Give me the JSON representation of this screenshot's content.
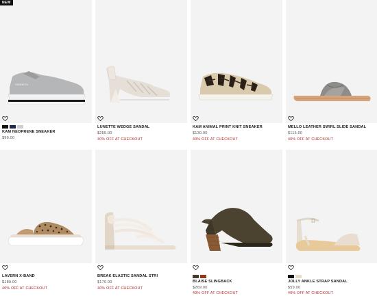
{
  "products": [
    {
      "badge": "NEW",
      "name": "KAM NEOPRENE SNEAKER",
      "price": "$99.00",
      "promo": "",
      "swatches": [
        "#111111",
        "#1d2a4a",
        "#cfcfcf"
      ],
      "icon": "heart-outline-icon"
    },
    {
      "badge": "",
      "name": "LUNETTE WEDGE SANDAL",
      "price": "$255.00",
      "promo": "40% OFF AT CHECKOUT",
      "swatches": [],
      "icon": "heart-outline-icon"
    },
    {
      "badge": "",
      "name": "KAM ANIMAL PRINT KNIT SNEAKER",
      "price": "$130.00",
      "promo": "40% OFF AT CHECKOUT",
      "swatches": [],
      "icon": "heart-outline-icon"
    },
    {
      "badge": "",
      "name": "MELLO LEATHER SWIRL SLIDE SANDAL",
      "price": "$115.00",
      "promo": "40% OFF AT CHECKOUT",
      "swatches": [],
      "icon": "heart-outline-icon"
    },
    {
      "badge": "",
      "name": "LAVERN X-BAND",
      "price": "$189.00",
      "promo": "40% OFF AT CHECKOUT",
      "swatches": [],
      "icon": "heart-outline-icon"
    },
    {
      "badge": "",
      "name": "BREAK ELASTIC SANDAL STRI",
      "price": "$170.00",
      "promo": "40% OFF AT CHECKOUT",
      "swatches": [],
      "icon": "heart-outline-icon"
    },
    {
      "badge": "",
      "name": "BLAISE SLINGBACK",
      "price": "$269.00",
      "promo": "40% OFF AT CHECKOUT",
      "swatches": [
        "#4a3a2a",
        "#8b3a1a"
      ],
      "icon": "heart-outline-icon"
    },
    {
      "badge": "",
      "name": "JOLLY ANKLE STRAP SANDAL",
      "price": "$59.00",
      "promo": "40% OFF AT CHECKOUT",
      "swatches": [
        "#111111",
        "#e8dcc8"
      ],
      "icon": "heart-outline-icon"
    }
  ],
  "colors": {
    "promo": "#b32424",
    "image_bg": "#f3f3f3"
  }
}
